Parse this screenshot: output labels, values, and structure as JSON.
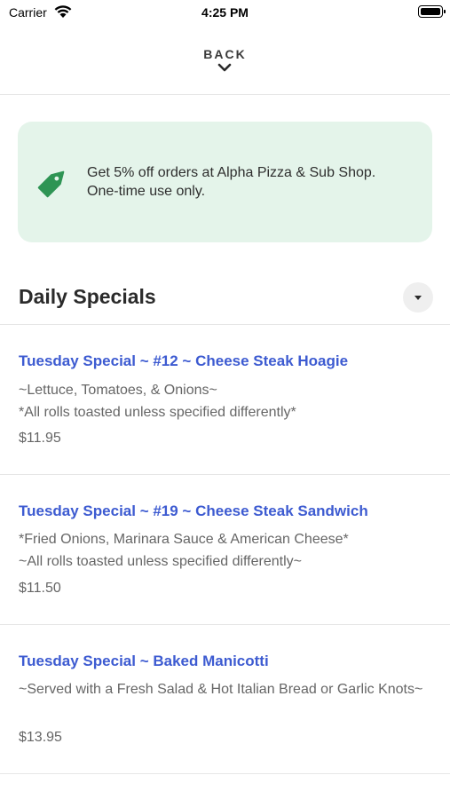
{
  "status_bar": {
    "carrier": "Carrier",
    "time": "4:25 PM"
  },
  "nav": {
    "back_label": "BACK"
  },
  "promo": {
    "text": "Get 5% off orders at Alpha Pizza & Sub Shop. One-time use only.",
    "icon": "tag-icon",
    "accent_color": "#2e9454",
    "background_color": "#e4f4ea"
  },
  "section": {
    "title": "Daily Specials"
  },
  "items": [
    {
      "name": "Tuesday Special ~ #12 ~ Cheese Steak Hoagie",
      "description": "~Lettuce, Tomatoes, & Onions~\n*All rolls toasted unless specified differently*",
      "price": "$11.95"
    },
    {
      "name": "Tuesday Special ~ #19 ~ Cheese Steak Sandwich",
      "description": "*Fried Onions, Marinara Sauce & American Cheese*\n~All rolls toasted unless specified differently~",
      "price": "$11.50"
    },
    {
      "name": "Tuesday Special ~ Baked Manicotti",
      "description": "~Served with a Fresh Salad & Hot Italian Bread or Garlic Knots~",
      "price": "$13.95"
    }
  ],
  "colors": {
    "item_title": "#3d5bd1",
    "secondary_text": "#666666"
  }
}
